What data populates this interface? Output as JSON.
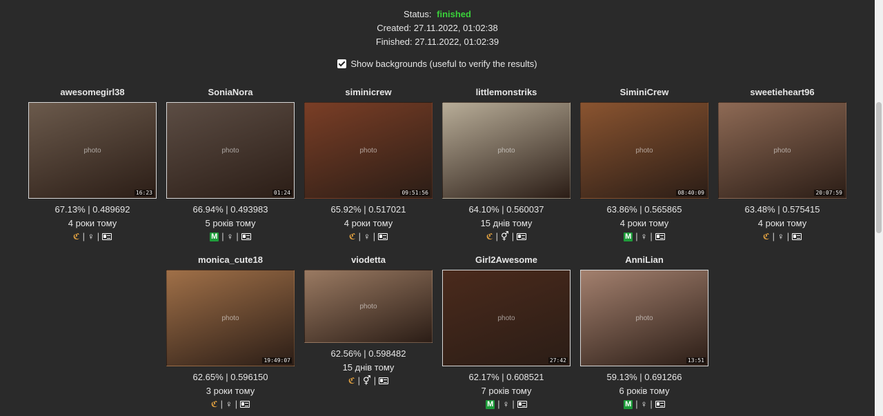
{
  "status": {
    "label": "Status:",
    "value": "finished",
    "created": "Created: 27.11.2022, 01:02:38",
    "finished": "Finished: 27.11.2022, 01:02:39"
  },
  "show_backgrounds": {
    "label": "Show backgrounds (useful to verify the results)",
    "checked": true
  },
  "results": [
    {
      "username": "awesomegirl38",
      "score": "67.13% | 0.489692",
      "age": "4 роки тому",
      "timestamp": "16:23",
      "icons": [
        "camera-icon",
        "female-icon",
        "id-card-icon"
      ],
      "photo_alt": "photo"
    },
    {
      "username": "SoniaNora",
      "score": "66.94% | 0.493983",
      "age": "5 років тому",
      "timestamp": "01:24",
      "icons": [
        "m-badge-icon",
        "female-icon",
        "id-card-icon"
      ],
      "photo_alt": "photo"
    },
    {
      "username": "siminicrew",
      "score": "65.92% | 0.517021",
      "age": "4 роки тому",
      "timestamp": "09:51:56",
      "icons": [
        "camera-icon",
        "female-icon",
        "id-card-icon"
      ],
      "photo_alt": "photo"
    },
    {
      "username": "littlemonstriks",
      "score": "64.10% | 0.560037",
      "age": "15 днів тому",
      "timestamp": "",
      "icons": [
        "camera-icon",
        "couple-icon",
        "id-card-icon"
      ],
      "photo_alt": "photo"
    },
    {
      "username": "SiminiCrew",
      "score": "63.86% | 0.565865",
      "age": "4 роки тому",
      "timestamp": "08:40:09",
      "icons": [
        "m-badge-icon",
        "female-icon",
        "id-card-icon"
      ],
      "photo_alt": "photo"
    },
    {
      "username": "sweetieheart96",
      "score": "63.48% | 0.575415",
      "age": "4 роки тому",
      "timestamp": "20:07:59",
      "icons": [
        "camera-icon",
        "female-icon",
        "id-card-icon"
      ],
      "photo_alt": "photo"
    },
    {
      "username": "monica_cute18",
      "score": "62.65% | 0.596150",
      "age": "3 роки тому",
      "timestamp": "19:49:07",
      "icons": [
        "camera-icon",
        "female-icon",
        "id-card-icon"
      ],
      "photo_alt": "photo"
    },
    {
      "username": "viodetta",
      "score": "62.56% | 0.598482",
      "age": "15 днів тому",
      "timestamp": "",
      "icons": [
        "camera-icon",
        "couple-icon",
        "id-card-icon"
      ],
      "photo_alt": "photo"
    },
    {
      "username": "Girl2Awesome",
      "score": "62.17% | 0.608521",
      "age": "7 років тому",
      "timestamp": "27:42",
      "icons": [
        "m-badge-icon",
        "female-icon",
        "id-card-icon"
      ],
      "photo_alt": "photo"
    },
    {
      "username": "AnniLian",
      "score": "59.13% | 0.691266",
      "age": "6 років тому",
      "timestamp": "13:51",
      "icons": [
        "m-badge-icon",
        "female-icon",
        "id-card-icon"
      ],
      "photo_alt": "photo"
    }
  ],
  "colors": {
    "background": "#2a2a2a",
    "status_finished": "#3ad13a",
    "m_badge": "#1e9c3a",
    "camera_icon": "#e0a040"
  }
}
